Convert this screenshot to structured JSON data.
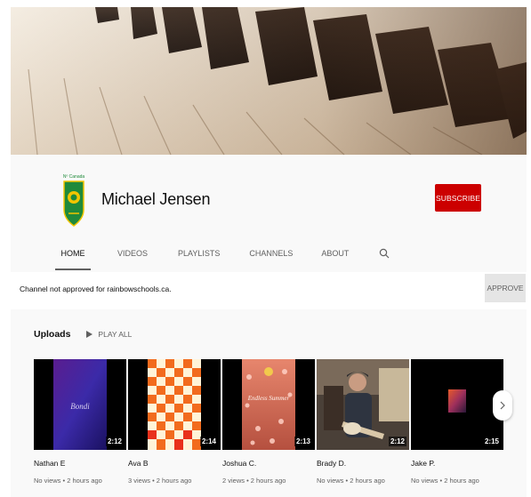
{
  "channel": {
    "name": "Michael Jensen",
    "subscribe_label": "SUBSCRIBE",
    "avatar_caption": "Nº Canada"
  },
  "tabs": [
    {
      "label": "HOME",
      "active": true
    },
    {
      "label": "VIDEOS",
      "active": false
    },
    {
      "label": "PLAYLISTS",
      "active": false
    },
    {
      "label": "CHANNELS",
      "active": false
    },
    {
      "label": "ABOUT",
      "active": false
    }
  ],
  "notice": {
    "text": "Channel not approved for rainbowschools.ca.",
    "approve_label": "APPROVE"
  },
  "uploads": {
    "title": "Uploads",
    "play_all_label": "PLAY ALL",
    "videos": [
      {
        "author": "Nathan E",
        "meta": "No views • 2 hours ago",
        "duration": "2:12"
      },
      {
        "author": "Ava B",
        "meta": "3 views • 2 hours ago",
        "duration": "2:14"
      },
      {
        "author": "Joshua C.",
        "meta": "2 views • 2 hours ago",
        "duration": "2:13"
      },
      {
        "author": "Brady D.",
        "meta": "No views • 2 hours ago",
        "duration": "2:12"
      },
      {
        "author": "Jake P.",
        "meta": "No views • 2 hours ago",
        "duration": "2:15"
      }
    ]
  },
  "thumbnail_text": {
    "video1": "Bondi",
    "video3": "Endless Summer"
  },
  "icons": {
    "search": "search-icon",
    "play": "play-icon",
    "next": "chevron-right-icon"
  },
  "colors": {
    "subscribe": "#cc0000",
    "approve_bg": "#e5e5e5",
    "avatar_green": "#1f8a3b",
    "avatar_yellow": "#f2c500"
  }
}
